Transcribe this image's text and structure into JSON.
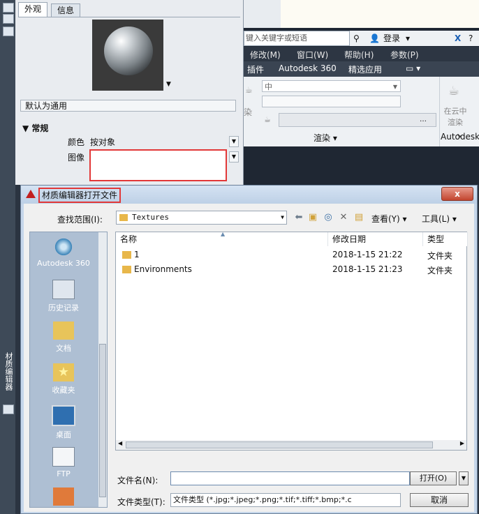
{
  "material_editor": {
    "tabs": [
      "外观",
      "信息"
    ],
    "material_name": "默认为通用",
    "section_title": "常规",
    "color_label": "颜色",
    "color_value": "按对象",
    "image_label": "图像",
    "vertical_panel_title": "材质编辑器"
  },
  "app": {
    "search_placeholder": "键入关键字或短语",
    "login_label": "登录",
    "menus": [
      "修改(M)",
      "窗口(W)",
      "帮助(H)",
      "参数(P)"
    ],
    "ribbon_tabs": [
      "插件",
      "Autodesk 360",
      "精选应用"
    ],
    "render_quality": "中",
    "render_panel_label": "渲染",
    "render_prefix": "染",
    "cloud_render_label": "在云中渲染",
    "autodesk_label": "Autodesk"
  },
  "dialog": {
    "title": "材质编辑器打开文件",
    "close_label": "x",
    "look_in_label": "查找范围(I):",
    "look_in_value": "Textures",
    "view_label": "查看(Y)",
    "tools_label": "工具(L)",
    "places": [
      "Autodesk 360",
      "历史记录",
      "文档",
      "收藏夹",
      "桌面",
      "FTP"
    ],
    "columns": [
      "名称",
      "修改日期",
      "类型"
    ],
    "files": [
      {
        "name": "1",
        "date": "2018-1-15 21:22",
        "type": "文件夹"
      },
      {
        "name": "Environments",
        "date": "2018-1-15 21:23",
        "type": "文件夹"
      }
    ],
    "file_name_label": "文件名(N):",
    "file_name_value": "",
    "file_type_label": "文件类型(T):",
    "file_type_value": "文件类型 (*.jpg;*.jpeg;*.png;*.tif;*.tiff;*.bmp;*.c",
    "open_label": "打开(O)",
    "cancel_label": "取消"
  },
  "colors": {
    "highlight": "#e23838",
    "title_bar": "#c5d6ea",
    "places_bar": "#aebfd3",
    "folder": "#e8b74a"
  }
}
